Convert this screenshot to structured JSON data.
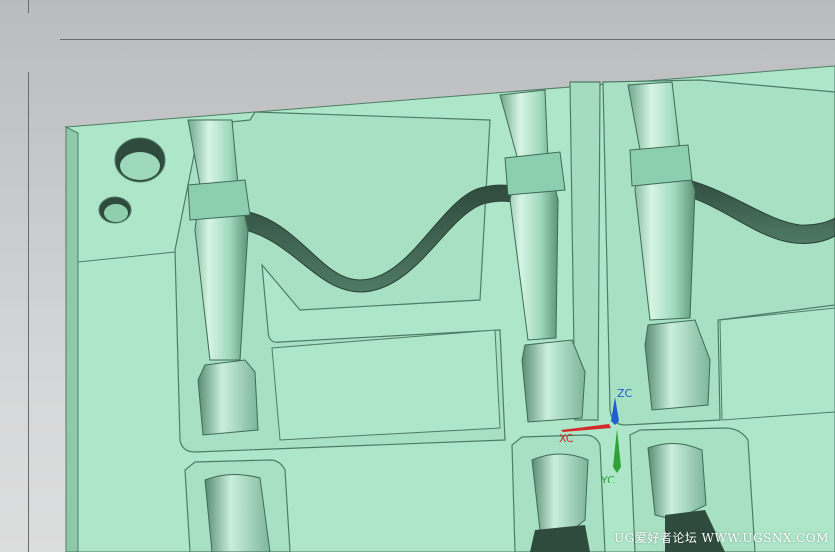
{
  "viewport": {
    "background_top": "#b9bbbd",
    "background_bottom": "#dcdddd",
    "model_color": "#aee6c9",
    "model_shadow": "#7fbfa0",
    "model_dark": "#3d5c4e"
  },
  "csys": {
    "zc_label": "ZC",
    "xc_label": "XC",
    "yc_label": "YC",
    "z_color": "#1f5fd1",
    "x_color": "#d22b2b",
    "y_color": "#2ea33a"
  },
  "watermark": {
    "text": "UG爱好者论坛 WWW.UGSNX.COM"
  }
}
